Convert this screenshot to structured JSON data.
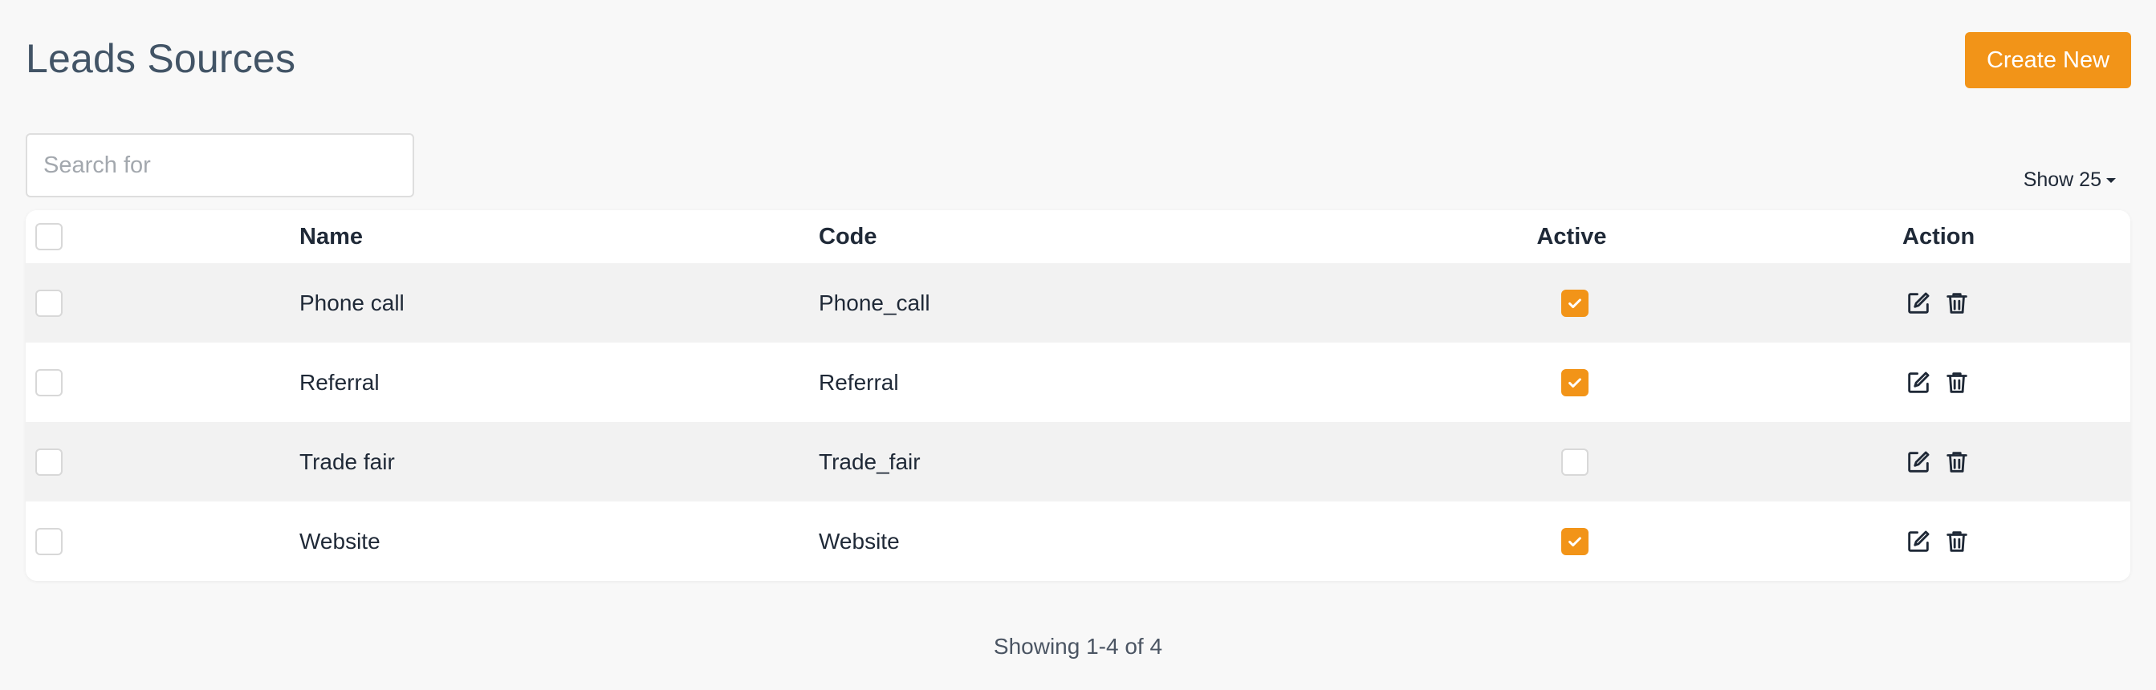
{
  "page": {
    "title": "Leads Sources",
    "create_label": "Create New"
  },
  "search": {
    "placeholder": "Search for",
    "value": ""
  },
  "pagination": {
    "show_label": "Show 25",
    "summary": "Showing 1-4 of 4"
  },
  "table": {
    "columns": {
      "name": "Name",
      "code": "Code",
      "active": "Active",
      "action": "Action"
    },
    "rows": [
      {
        "name": "Phone call",
        "code": "Phone_call",
        "active": true
      },
      {
        "name": "Referral",
        "code": "Referral",
        "active": true
      },
      {
        "name": "Trade fair",
        "code": "Trade_fair",
        "active": false
      },
      {
        "name": "Website",
        "code": "Website",
        "active": true
      }
    ]
  },
  "icons": {
    "edit": "edit-icon",
    "delete": "trash-icon",
    "check": "check-icon"
  },
  "colors": {
    "accent": "#f29418",
    "title": "#425466",
    "row_alt": "#f2f2f2"
  }
}
